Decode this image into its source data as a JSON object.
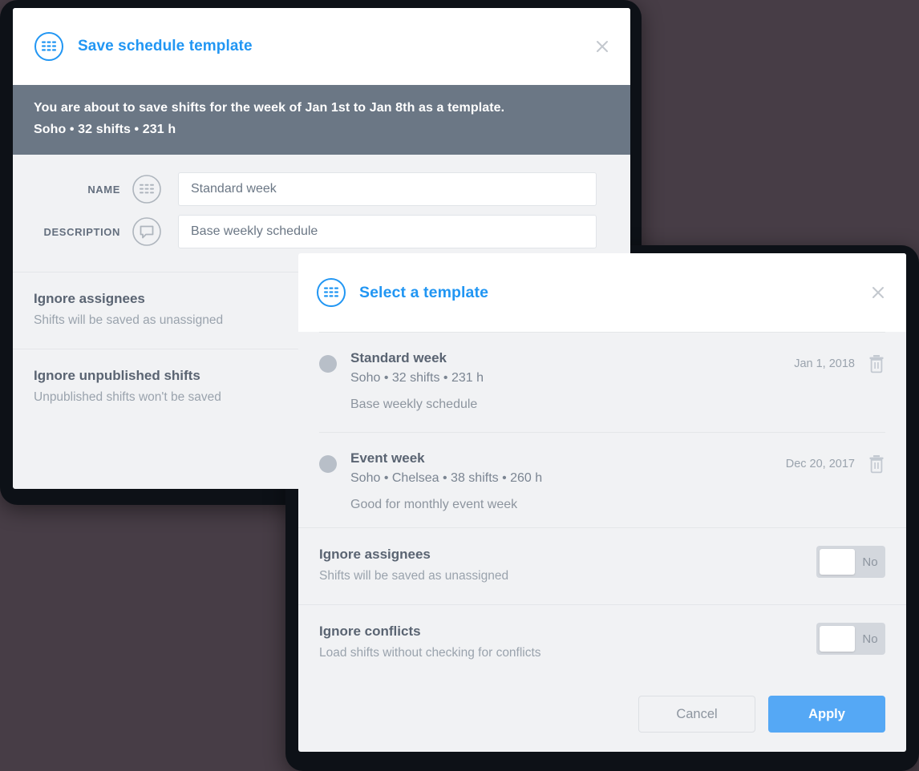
{
  "background_color": "#473d46",
  "accent_color": "#2196f3",
  "banner_color": "#6b7785",
  "apply_button_color": "#55a8f5",
  "save_dialog": {
    "icon": "calendar-grid-icon",
    "title": "Save schedule template",
    "close_icon": "close-icon",
    "banner": {
      "line1": "You are about to save shifts for the week of Jan 1st to Jan 8th as a template.",
      "line2": "Soho • 32 shifts • 231 h"
    },
    "fields": [
      {
        "label": "NAME",
        "icon": "calendar-grid-icon",
        "value": "Standard week",
        "placeholder": "Standard week"
      },
      {
        "label": "DESCRIPTION",
        "icon": "comment-bubble-icon",
        "value": "Base weekly schedule",
        "placeholder": "Base weekly schedule"
      }
    ],
    "options": [
      {
        "title": "Ignore assignees",
        "subtitle": "Shifts will be saved as unassigned"
      },
      {
        "title": "Ignore unpublished shifts",
        "subtitle": "Unpublished shifts won't be saved"
      }
    ]
  },
  "select_dialog": {
    "icon": "calendar-grid-icon",
    "title": "Select a template",
    "close_icon": "close-icon",
    "templates": [
      {
        "name": "Standard week",
        "meta": "Soho • 32 shifts • 231 h",
        "description": "Base weekly schedule",
        "date": "Jan 1, 2018",
        "delete_icon": "trash-icon",
        "selected": false
      },
      {
        "name": "Event week",
        "meta": "Soho • Chelsea • 38 shifts • 260 h",
        "description": "Good for monthly event week",
        "date": "Dec 20, 2017",
        "delete_icon": "trash-icon",
        "selected": false
      }
    ],
    "options": [
      {
        "title": "Ignore assignees",
        "subtitle": "Shifts will be saved as unassigned",
        "toggle_label": "No",
        "toggle_state": "off"
      },
      {
        "title": "Ignore conflicts",
        "subtitle": "Load shifts without checking for conflicts",
        "toggle_label": "No",
        "toggle_state": "off"
      }
    ],
    "footer": {
      "cancel_label": "Cancel",
      "apply_label": "Apply"
    }
  }
}
